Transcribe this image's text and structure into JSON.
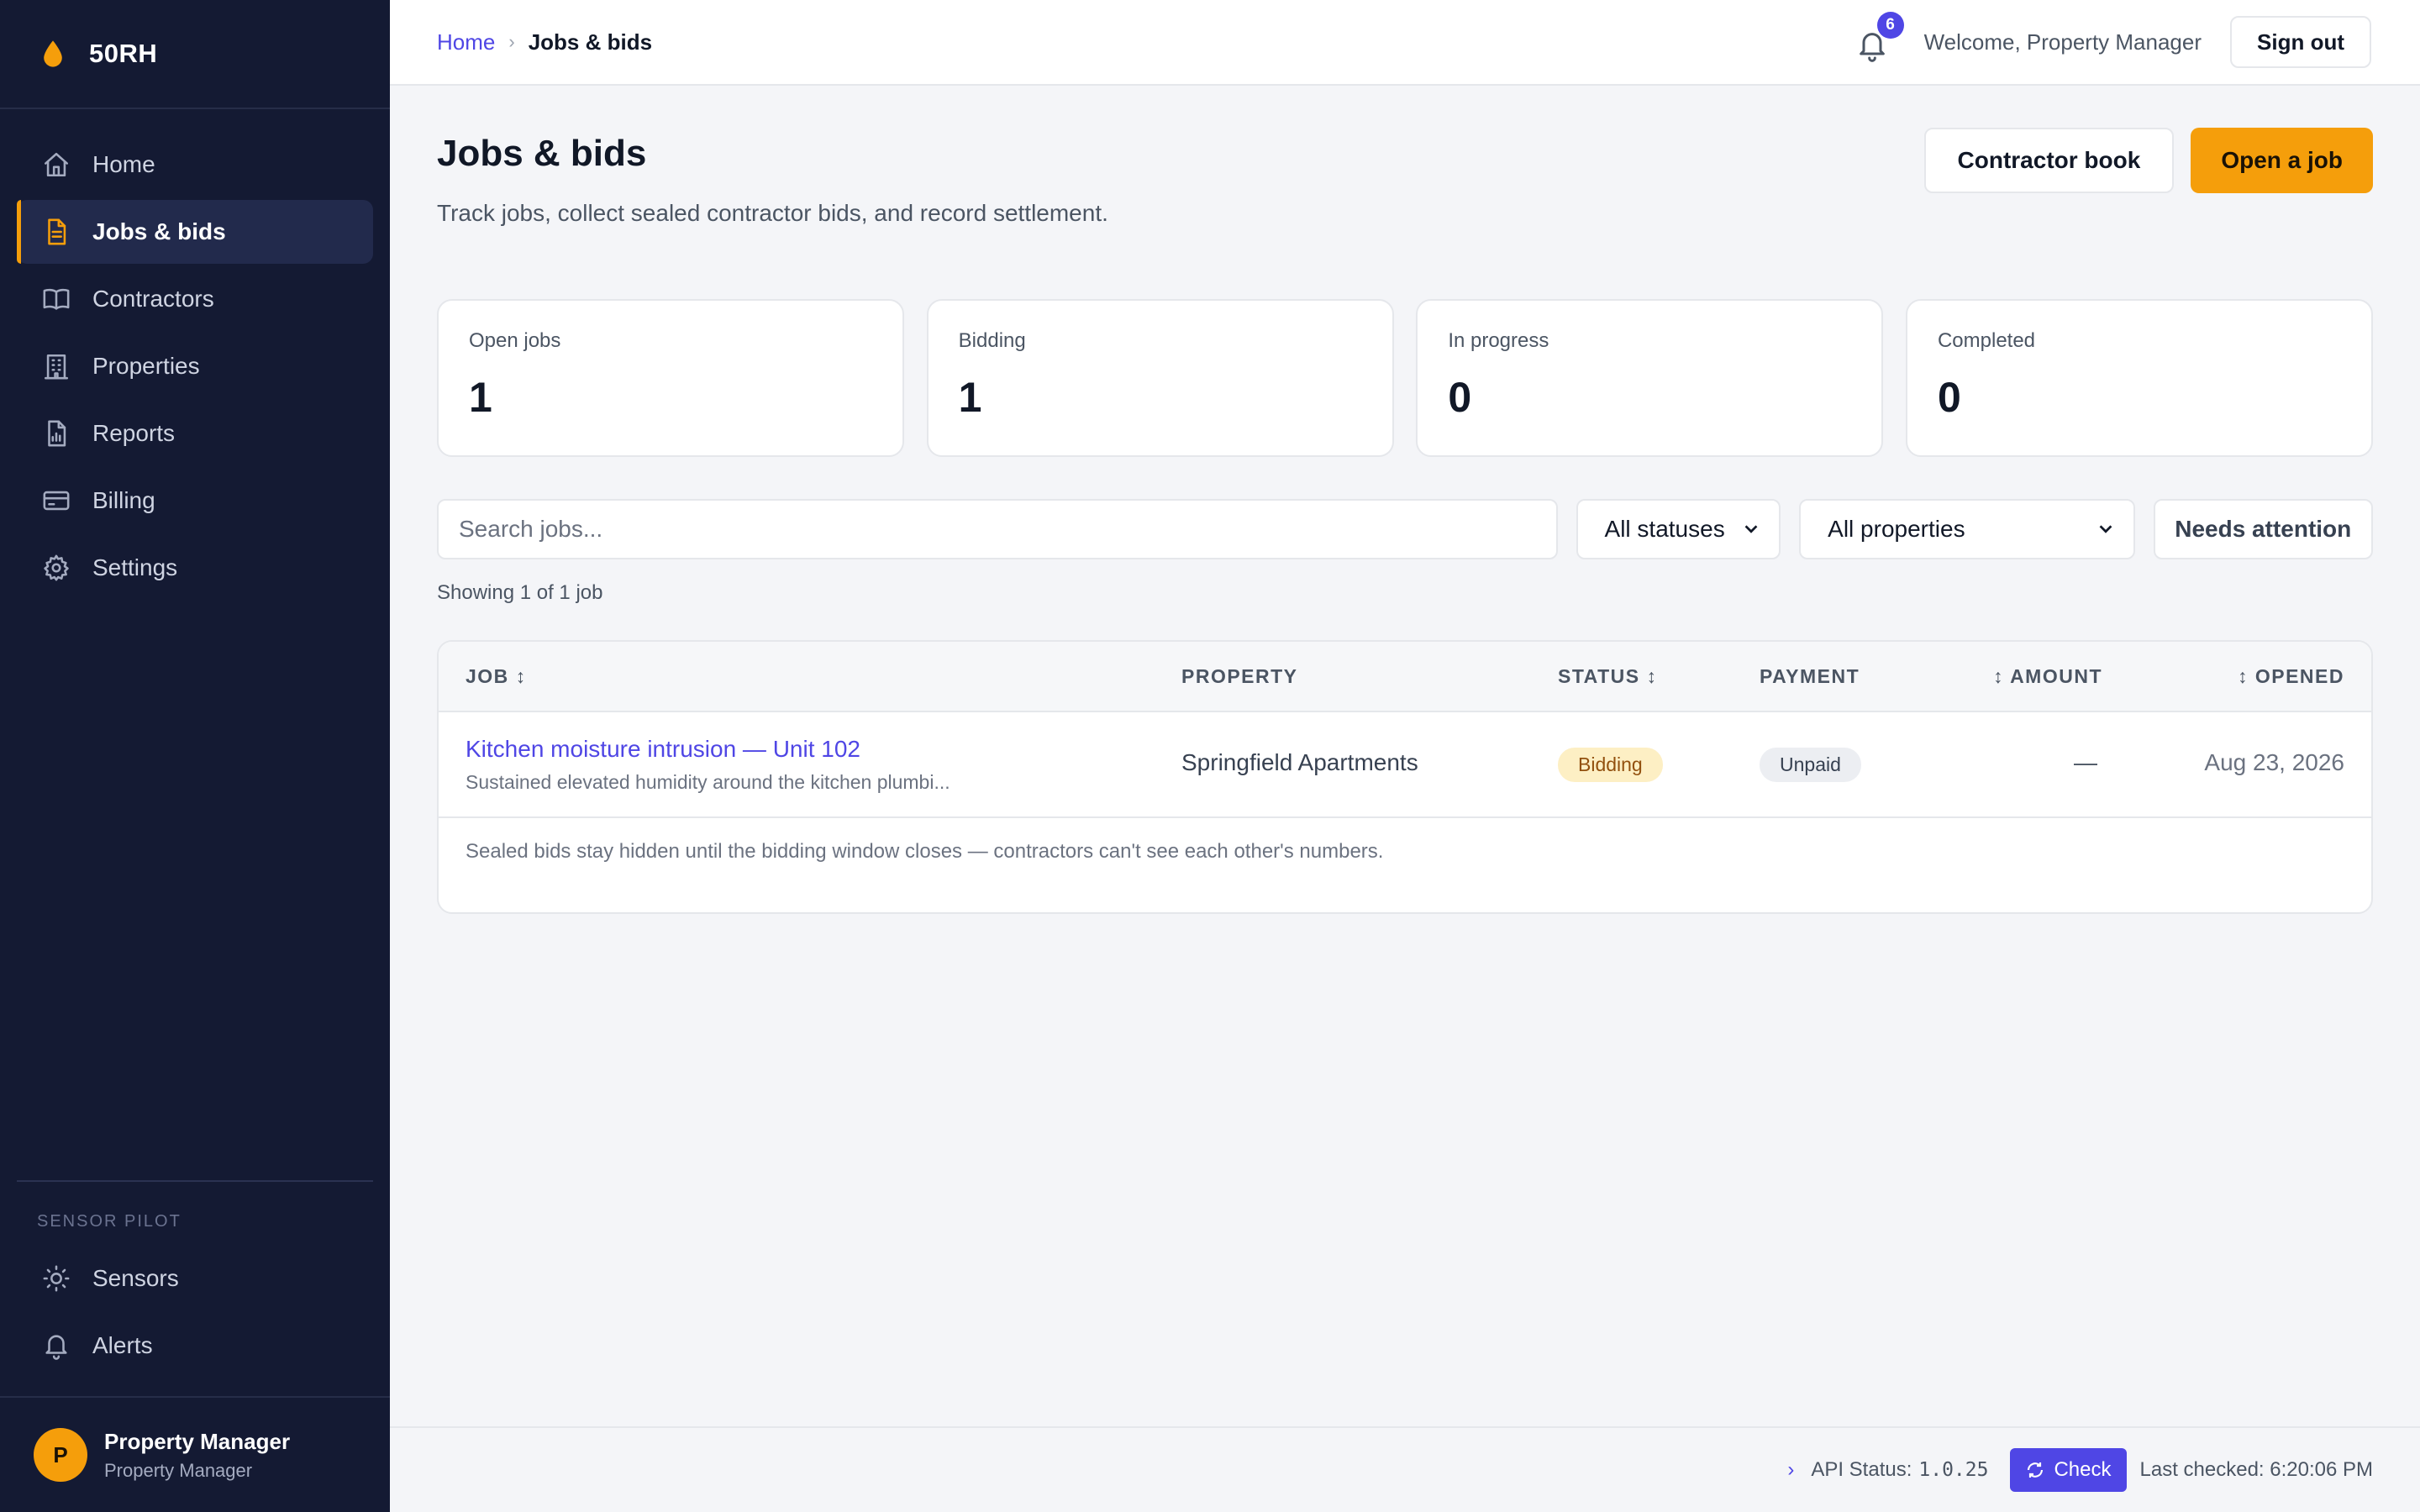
{
  "brand": {
    "name": "50RH"
  },
  "sidebar": {
    "items": [
      {
        "label": "Home",
        "icon": "home-icon"
      },
      {
        "label": "Jobs & bids",
        "icon": "document-icon",
        "active": true
      },
      {
        "label": "Contractors",
        "icon": "book-icon"
      },
      {
        "label": "Properties",
        "icon": "building-icon"
      },
      {
        "label": "Reports",
        "icon": "report-icon"
      },
      {
        "label": "Billing",
        "icon": "credit-card-icon"
      },
      {
        "label": "Settings",
        "icon": "gear-icon"
      }
    ],
    "section_label": "SENSOR PILOT",
    "sensor_items": [
      {
        "label": "Sensors",
        "icon": "sun-icon"
      },
      {
        "label": "Alerts",
        "icon": "bell-icon"
      }
    ],
    "user": {
      "initial": "P",
      "name": "Property Manager",
      "role": "Property Manager"
    }
  },
  "topbar": {
    "breadcrumb": {
      "home": "Home",
      "separator": "›",
      "current": "Jobs & bids"
    },
    "notifications_count": "6",
    "welcome": "Welcome, Property Manager",
    "sign_out": "Sign out"
  },
  "page": {
    "title": "Jobs & bids",
    "subtitle": "Track jobs, collect sealed contractor bids, and record settlement.",
    "contractor_book": "Contractor book",
    "open_job": "Open a job"
  },
  "stats": [
    {
      "label": "Open jobs",
      "value": "1"
    },
    {
      "label": "Bidding",
      "value": "1"
    },
    {
      "label": "In progress",
      "value": "0"
    },
    {
      "label": "Completed",
      "value": "0"
    }
  ],
  "filters": {
    "search_placeholder": "Search jobs...",
    "status_selected": "All statuses",
    "property_selected": "All properties",
    "needs_attention": "Needs attention"
  },
  "showing": "Showing 1 of 1 job",
  "table": {
    "headers": {
      "job": "JOB ↕",
      "property": "PROPERTY",
      "status": "STATUS ↕",
      "payment": "PAYMENT",
      "amount": "↕ AMOUNT",
      "opened": "↕ OPENED"
    },
    "rows": [
      {
        "title": "Kitchen moisture intrusion — Unit 102",
        "description": "Sustained elevated humidity around the kitchen plumbi...",
        "property": "Springfield Apartments",
        "status": "Bidding",
        "payment": "Unpaid",
        "amount": "—",
        "opened": "Aug 23, 2026"
      }
    ],
    "footnote": "Sealed bids stay hidden until the bidding window closes — contractors can't see each other's numbers."
  },
  "statusbar": {
    "chevron": "›",
    "label": "API Status:",
    "version": "1.0.25",
    "check": "Check",
    "last_checked": "Last checked: 6:20:06 PM"
  },
  "colors": {
    "sidebar_bg": "#141a33",
    "accent": "#f59e0b",
    "link": "#4f46e5",
    "page_bg": "#f4f5f8"
  }
}
